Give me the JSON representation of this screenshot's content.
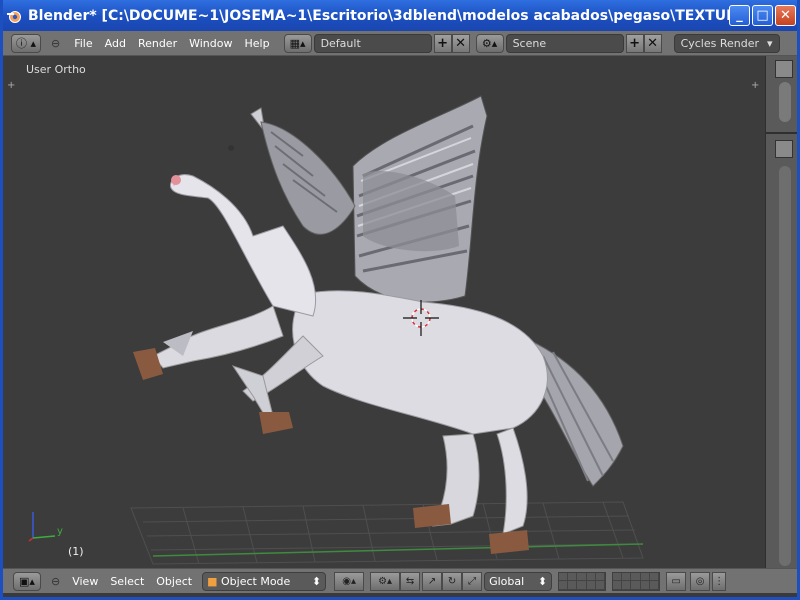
{
  "window": {
    "title": "Blender* [C:\\DOCUME~1\\JOSEMA~1\\Escritorio\\3dblend\\modelos acabados\\pegaso\\TEXTURAS\\armature\\acabad...",
    "minimize": "_",
    "maximize": "□",
    "close": "✕"
  },
  "menubar": {
    "menus": [
      "File",
      "Add",
      "Render",
      "Window",
      "Help"
    ],
    "layout": "Default",
    "scene": "Scene",
    "engine": "Cycles Render"
  },
  "viewport": {
    "view_label": "User Ortho",
    "frame_label": "(1)",
    "axis_y": "y"
  },
  "bottombar": {
    "menus": [
      "View",
      "Select",
      "Object"
    ],
    "mode": "Object Mode",
    "orientation": "Global"
  }
}
